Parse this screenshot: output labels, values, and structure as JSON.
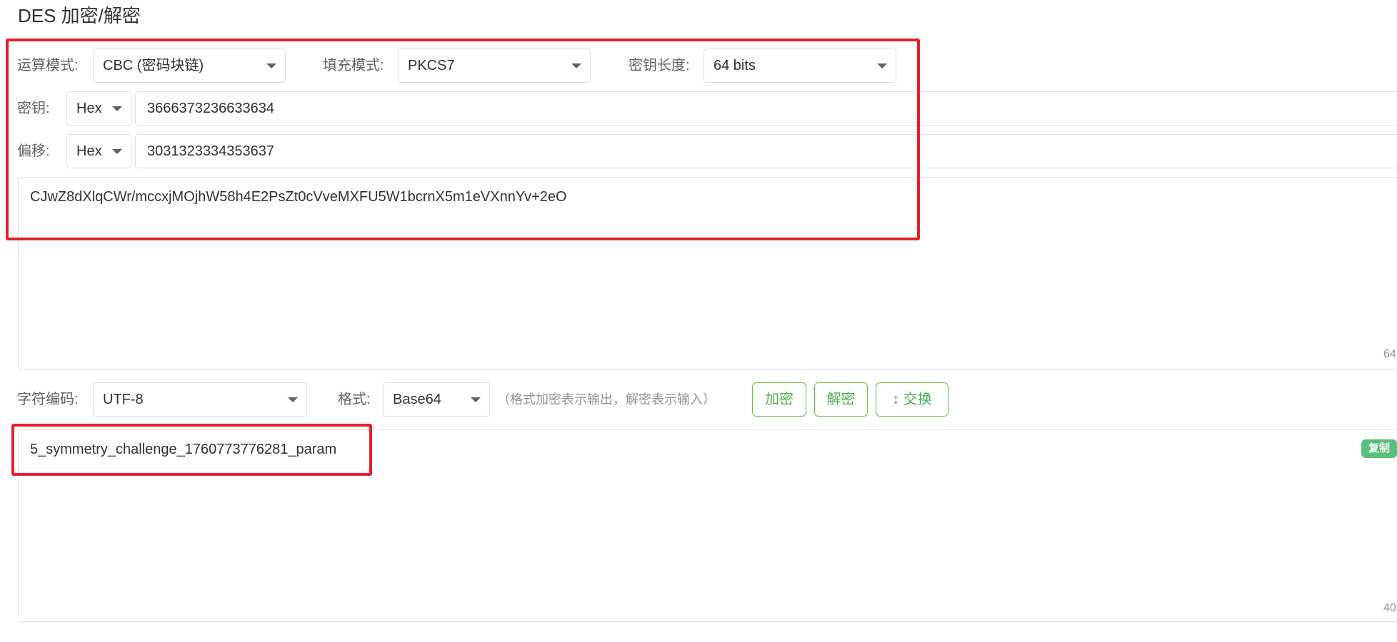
{
  "page": {
    "title": "DES 加密/解密"
  },
  "settings": {
    "mode_label": "运算模式:",
    "mode_value": "CBC (密码块链)",
    "padding_label": "填充模式:",
    "padding_value": "PKCS7",
    "keylen_label": "密钥长度:",
    "keylen_value": "64 bits"
  },
  "key": {
    "label": "密钥:",
    "format": "Hex",
    "value": "3666373236633634"
  },
  "iv": {
    "label": "偏移:",
    "format": "Hex",
    "value": "3031323334353637"
  },
  "input": {
    "value": "CJwZ8dXlqCWr/mccxjMOjhW58h4E2PsZt0cVveMXFU5W1bcrnX5m1eVXnnYv+2eO",
    "char_count": "64"
  },
  "options": {
    "charset_label": "字符编码:",
    "charset_value": "UTF-8",
    "format_label": "格式:",
    "format_value": "Base64",
    "format_hint": "（格式加密表示输出，解密表示输入）"
  },
  "actions": {
    "encrypt_label": "加密",
    "decrypt_label": "解密",
    "swap_icon": "up-down-arrow-icon",
    "swap_label": "交换"
  },
  "output": {
    "value": "5_symmetry_challenge_1760773776281_param",
    "char_count": "40",
    "copy_label": "复制"
  },
  "colors": {
    "accent_green": "#67c23a",
    "highlight_red": "#e3202a",
    "copy_badge": "#58c17b"
  }
}
